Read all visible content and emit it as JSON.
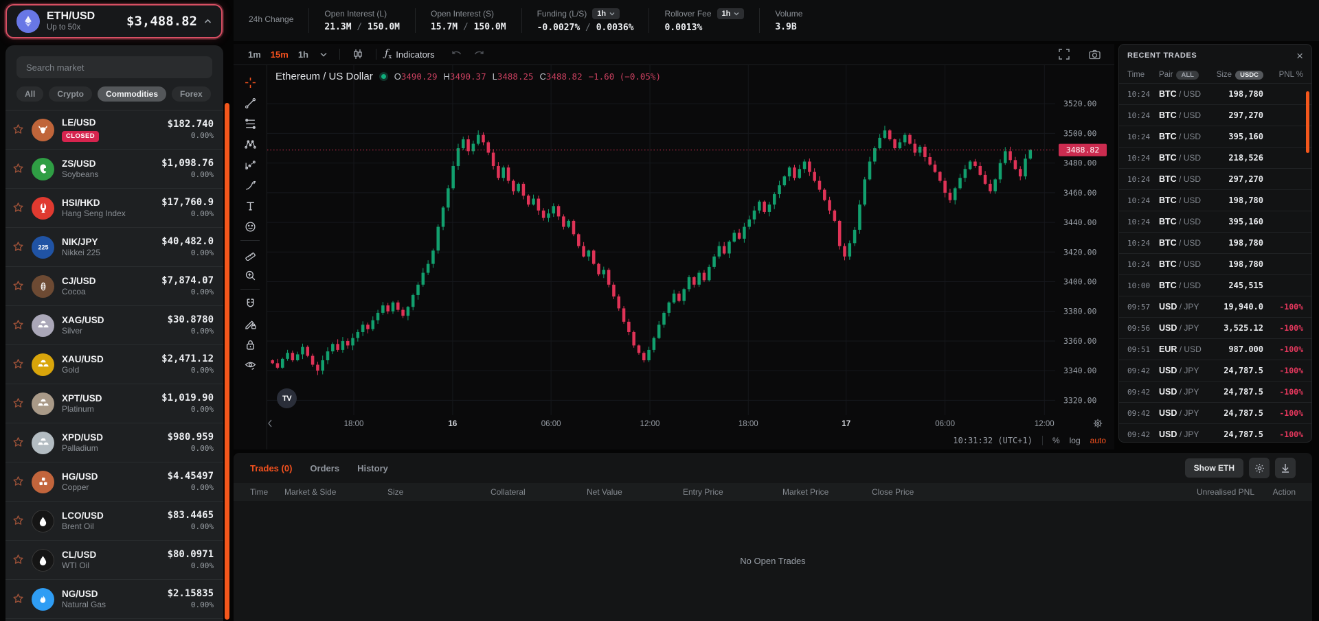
{
  "colors": {
    "accent_orange": "#f4511e",
    "up_green": "#12a06e",
    "down_red": "#e03357",
    "badge_red": "#cc2c50",
    "closed_pink": "#d6244e",
    "pnl_red": "#e8385e",
    "selector_border": "#d84f63"
  },
  "pair_selector": {
    "symbol": "ETH/USD",
    "leverage": "Up to 50x",
    "price": "$3,488.82",
    "icon": "ethereum-icon"
  },
  "stats_bar": {
    "items": [
      {
        "label": "24h Change",
        "skeleton": true
      },
      {
        "label": "Open Interest (L)",
        "value": "21.3M / 150.0M"
      },
      {
        "label": "Open Interest (S)",
        "value": "15.7M / 150.0M"
      },
      {
        "label": "Funding (L/S)",
        "dropdown": "1h",
        "value": "-0.0027% / 0.0036%"
      },
      {
        "label": "Rollover Fee",
        "dropdown": "1h",
        "value": "0.0013%"
      },
      {
        "label": "Volume",
        "value": "3.9B"
      }
    ]
  },
  "sidebar": {
    "search_placeholder": "Search market",
    "filters": [
      {
        "label": "All",
        "active": false
      },
      {
        "label": "Crypto",
        "active": false
      },
      {
        "label": "Commodities",
        "active": true
      },
      {
        "label": "Forex",
        "active": false
      }
    ],
    "markets": [
      {
        "symbol": "LE/USD",
        "name": "",
        "badge": "CLOSED",
        "price": "$182.740",
        "change": "0.00%",
        "icon": "cow",
        "color": "#c0653a"
      },
      {
        "symbol": "ZS/USD",
        "name": "Soybeans",
        "price": "$1,098.76",
        "change": "0.00%",
        "icon": "bean",
        "color": "#2f9e44"
      },
      {
        "symbol": "HSI/HKD",
        "name": "Hang Seng Index",
        "price": "$17,760.9",
        "change": "0.00%",
        "icon": "hsi",
        "color": "#e03a30"
      },
      {
        "symbol": "NIK/JPY",
        "name": "Nikkei 225",
        "price": "$40,482.0",
        "change": "0.00%",
        "icon": "n225",
        "color": "#2053a4"
      },
      {
        "symbol": "CJ/USD",
        "name": "Cocoa",
        "price": "$7,874.07",
        "change": "0.00%",
        "icon": "cocoa",
        "color": "#6d4a33"
      },
      {
        "symbol": "XAG/USD",
        "name": "Silver",
        "price": "$30.8780",
        "change": "0.00%",
        "icon": "bars",
        "color": "#aaa7b8"
      },
      {
        "symbol": "XAU/USD",
        "name": "Gold",
        "price": "$2,471.12",
        "change": "0.00%",
        "icon": "bars",
        "color": "#d9a50b"
      },
      {
        "symbol": "XPT/USD",
        "name": "Platinum",
        "price": "$1,019.90",
        "change": "0.00%",
        "icon": "bars",
        "color": "#a99a88"
      },
      {
        "symbol": "XPD/USD",
        "name": "Palladium",
        "price": "$980.959",
        "change": "0.00%",
        "icon": "bars",
        "color": "#b3bcc2"
      },
      {
        "symbol": "HG/USD",
        "name": "Copper",
        "price": "$4.45497",
        "change": "0.00%",
        "icon": "cubes",
        "color": "#c2653c"
      },
      {
        "symbol": "LCO/USD",
        "name": "Brent Oil",
        "price": "$83.4465",
        "change": "0.00%",
        "icon": "drop",
        "color": "#151515"
      },
      {
        "symbol": "CL/USD",
        "name": "WTI Oil",
        "price": "$80.0971",
        "change": "0.00%",
        "icon": "drop",
        "color": "#151515"
      },
      {
        "symbol": "NG/USD",
        "name": "Natural Gas",
        "price": "$2.15835",
        "change": "0.00%",
        "icon": "flame",
        "color": "#2f9df4"
      }
    ]
  },
  "chart": {
    "timeframes": [
      {
        "label": "1m",
        "active": false
      },
      {
        "label": "15m",
        "active": true
      },
      {
        "label": "1h",
        "active": false
      }
    ],
    "indicators_label": "Indicators",
    "toolbar_icons": [
      "candles-icon",
      "indicators-fx-icon",
      "undo-icon",
      "redo-icon",
      "fullscreen-icon",
      "camera-icon"
    ],
    "draw_toolbar_icons": [
      "crosshair",
      "trend-line",
      "fib-retracement",
      "xabcd-pattern",
      "forecast",
      "brush",
      "text",
      "emoji",
      "ruler",
      "zoom-in",
      "magnet",
      "drawing-mode",
      "lock",
      "eye"
    ],
    "legend": {
      "title": "Ethereum / US Dollar",
      "o_label": "O",
      "o": "3490.29",
      "h_label": "H",
      "h": "3490.37",
      "l_label": "L",
      "l": "3488.25",
      "c_label": "C",
      "c": "3488.82",
      "change": "−1.60 (−0.05%)"
    },
    "last_price_label": "3488.82",
    "tv_logo": "TV",
    "status": {
      "clock": "10:31:32 (UTC+1)",
      "percent": "%",
      "log": "log",
      "auto": "auto"
    }
  },
  "chart_data": {
    "type": "candlestick",
    "title": "Ethereum / US Dollar",
    "timeframe": "15m",
    "ylim": [
      3310,
      3546
    ],
    "y_ticks": [
      3520,
      3500,
      3480,
      3460,
      3440,
      3420,
      3400,
      3380,
      3360,
      3340,
      3320
    ],
    "x_labels": [
      {
        "pos": 16.2,
        "label": "18:00",
        "major": false
      },
      {
        "pos": 35.9,
        "label": "16",
        "major": true
      },
      {
        "pos": 55.5,
        "label": "06:00",
        "major": false
      },
      {
        "pos": 75.2,
        "label": "12:00",
        "major": false
      },
      {
        "pos": 94.8,
        "label": "18:00",
        "major": false
      },
      {
        "pos": 114.3,
        "label": "17",
        "major": true
      },
      {
        "pos": 134.0,
        "label": "06:00",
        "major": false
      },
      {
        "pos": 153.8,
        "label": "12:00",
        "major": false
      }
    ],
    "price_line": 3488.82,
    "up_color": "#12a06e",
    "down_color": "#e03357",
    "grid": true,
    "closes": [
      3345,
      3342,
      3348,
      3352,
      3347,
      3351,
      3356,
      3350,
      3344,
      3340,
      3347,
      3353,
      3358,
      3354,
      3360,
      3357,
      3362,
      3366,
      3371,
      3368,
      3374,
      3379,
      3384,
      3380,
      3386,
      3381,
      3377,
      3383,
      3391,
      3398,
      3406,
      3412,
      3421,
      3437,
      3450,
      3463,
      3478,
      3490,
      3496,
      3488,
      3493,
      3499,
      3494,
      3487,
      3478,
      3470,
      3477,
      3468,
      3461,
      3466,
      3458,
      3452,
      3456,
      3448,
      3443,
      3446,
      3451,
      3444,
      3437,
      3441,
      3432,
      3424,
      3417,
      3421,
      3412,
      3405,
      3408,
      3398,
      3390,
      3382,
      3373,
      3366,
      3357,
      3352,
      3347,
      3354,
      3362,
      3371,
      3379,
      3386,
      3392,
      3387,
      3395,
      3403,
      3398,
      3406,
      3401,
      3410,
      3417,
      3424,
      3419,
      3427,
      3433,
      3429,
      3437,
      3442,
      3448,
      3454,
      3447,
      3452,
      3459,
      3465,
      3471,
      3477,
      3470,
      3476,
      3481,
      3474,
      3468,
      3462,
      3455,
      3448,
      3441,
      3424,
      3417,
      3426,
      3435,
      3452,
      3469,
      3481,
      3490,
      3497,
      3502,
      3496,
      3490,
      3494,
      3499,
      3493,
      3487,
      3491,
      3484,
      3479,
      3474,
      3468,
      3460,
      3455,
      3463,
      3470,
      3476,
      3481,
      3478,
      3472,
      3466,
      3461,
      3469,
      3480,
      3488,
      3482,
      3476,
      3471,
      3483,
      3488.8
    ]
  },
  "recent_trades": {
    "title": "RECENT TRADES",
    "columns": {
      "time": "Time",
      "pair": "Pair",
      "pair_badge": "ALL",
      "size": "Size",
      "size_badge": "USDC",
      "pnl": "PNL %"
    },
    "rows": [
      {
        "time": "10:24",
        "base": "BTC",
        "quote": "USD",
        "size": "198,780",
        "pnl": ""
      },
      {
        "time": "10:24",
        "base": "BTC",
        "quote": "USD",
        "size": "297,270",
        "pnl": ""
      },
      {
        "time": "10:24",
        "base": "BTC",
        "quote": "USD",
        "size": "395,160",
        "pnl": ""
      },
      {
        "time": "10:24",
        "base": "BTC",
        "quote": "USD",
        "size": "218,526",
        "pnl": ""
      },
      {
        "time": "10:24",
        "base": "BTC",
        "quote": "USD",
        "size": "297,270",
        "pnl": ""
      },
      {
        "time": "10:24",
        "base": "BTC",
        "quote": "USD",
        "size": "198,780",
        "pnl": ""
      },
      {
        "time": "10:24",
        "base": "BTC",
        "quote": "USD",
        "size": "395,160",
        "pnl": ""
      },
      {
        "time": "10:24",
        "base": "BTC",
        "quote": "USD",
        "size": "198,780",
        "pnl": ""
      },
      {
        "time": "10:24",
        "base": "BTC",
        "quote": "USD",
        "size": "198,780",
        "pnl": ""
      },
      {
        "time": "10:00",
        "base": "BTC",
        "quote": "USD",
        "size": "245,515",
        "pnl": ""
      },
      {
        "time": "09:57",
        "base": "USD",
        "quote": "JPY",
        "size": "19,940.0",
        "pnl": "-100%"
      },
      {
        "time": "09:56",
        "base": "USD",
        "quote": "JPY",
        "size": "3,525.12",
        "pnl": "-100%"
      },
      {
        "time": "09:51",
        "base": "EUR",
        "quote": "USD",
        "size": "987.000",
        "pnl": "-100%"
      },
      {
        "time": "09:42",
        "base": "USD",
        "quote": "JPY",
        "size": "24,787.5",
        "pnl": "-100%"
      },
      {
        "time": "09:42",
        "base": "USD",
        "quote": "JPY",
        "size": "24,787.5",
        "pnl": "-100%"
      },
      {
        "time": "09:42",
        "base": "USD",
        "quote": "JPY",
        "size": "24,787.5",
        "pnl": "-100%"
      },
      {
        "time": "09:42",
        "base": "USD",
        "quote": "JPY",
        "size": "24,787.5",
        "pnl": "-100%"
      }
    ]
  },
  "positions_panel": {
    "tabs": [
      {
        "label": "Trades (0)",
        "active": true
      },
      {
        "label": "Orders",
        "active": false
      },
      {
        "label": "History",
        "active": false
      }
    ],
    "show_eth_label": "Show ETH",
    "action_icons": [
      "gear-icon",
      "download-icon"
    ],
    "columns": [
      "Time",
      "Market & Side",
      "Size",
      "Collateral",
      "Net Value",
      "Entry Price",
      "Market Price",
      "Close Price",
      "Unrealised PNL",
      "Action"
    ],
    "empty_message": "No Open Trades"
  }
}
